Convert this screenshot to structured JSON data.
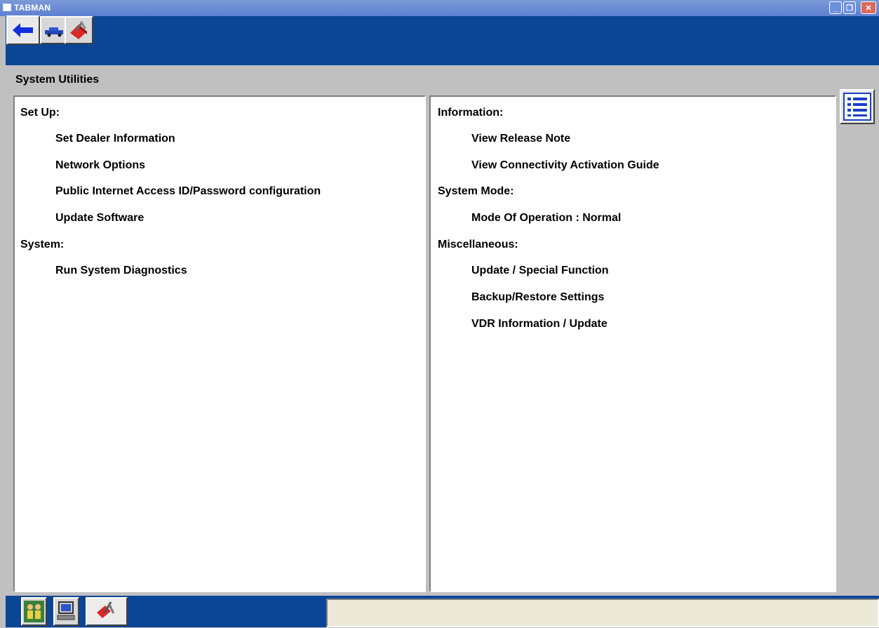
{
  "window": {
    "title": "TABMAN",
    "minimize_label": "_",
    "maximize_label": "❐",
    "close_label": "✕"
  },
  "toolbar": {
    "tabs": [
      {
        "icon": "back-arrow-icon"
      },
      {
        "icon": "vehicle-icon"
      },
      {
        "icon": "toolbox-icon"
      }
    ]
  },
  "page": {
    "title": "System Utilities"
  },
  "left_panel": {
    "setup_heading": "Set Up:",
    "setup_items": [
      "Set Dealer Information",
      "Network Options",
      "Public Internet Access ID/Password configuration",
      "Update Software"
    ],
    "system_heading": "System:",
    "system_items": [
      "Run System Diagnostics"
    ]
  },
  "right_panel": {
    "information_heading": "Information:",
    "information_items": [
      "View Release Note",
      "View Connectivity Activation Guide"
    ],
    "mode_heading": "System Mode:",
    "mode_items": [
      "Mode Of Operation : Normal"
    ],
    "misc_heading": "Miscellaneous:",
    "misc_items": [
      "Update / Special Function",
      "Backup/Restore Settings",
      "VDR Information / Update"
    ]
  },
  "side": {
    "menu_icon": "list-menu-icon"
  },
  "bottom": {
    "tabs": [
      {
        "icon": "people-icon"
      },
      {
        "icon": "computer-icon"
      },
      {
        "icon": "tools-icon"
      }
    ],
    "status_text": ""
  },
  "colors": {
    "toolbar_blue": "#0a4596",
    "titlebar_blue": "#5c7fd1",
    "panel_background": "#ffffff",
    "app_background": "#c0c0c0"
  }
}
